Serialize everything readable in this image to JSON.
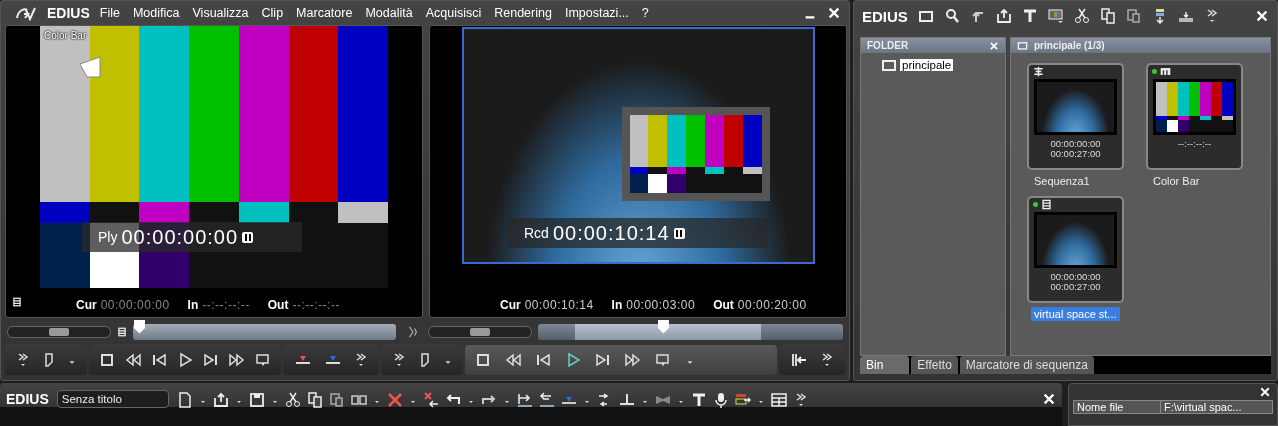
{
  "menu_bar": {
    "app_name": "EDIUS",
    "items": [
      "File",
      "Modifica",
      "Visualizza",
      "Clip",
      "Marcatore",
      "Modalità",
      "Acquisisci",
      "Rendering",
      "Impostazi...",
      "?"
    ]
  },
  "monitors": [
    {
      "kind": "player",
      "clip_label": "Color Bar",
      "mode": "Ply",
      "timecode": "00:00:00:00",
      "readouts": [
        {
          "label": "Cur",
          "value": "00:00:00:00"
        },
        {
          "label": "In",
          "value": "--:--:--:--"
        },
        {
          "label": "Out",
          "value": "--:--:--:--"
        }
      ],
      "shuttle": {
        "level": 0.5
      },
      "scrubber": {
        "level": 0.0
      }
    },
    {
      "kind": "recorder",
      "mode": "Rcd",
      "timecode": "00:00:10:14",
      "readouts": [
        {
          "label": "Cur",
          "value": "00:00:10:14"
        },
        {
          "label": "In",
          "value": "00:00:03:00"
        },
        {
          "label": "Out",
          "value": "00:00:20:00"
        }
      ],
      "shuttle": {
        "level": 0.5
      },
      "scrubber": {
        "level": 0.39
      }
    }
  ],
  "bin_window": {
    "app_name": "EDIUS",
    "folder_panel": {
      "title": "FOLDER",
      "items": [
        {
          "label": "principale",
          "selected": true
        }
      ]
    },
    "bin": {
      "title": "principale (1/3)",
      "clips": [
        {
          "kind": "sequence",
          "timecodes": [
            "00:00:00:00",
            "00:00:27:00"
          ],
          "name": "Sequenza1",
          "in_use": false,
          "selected": false
        },
        {
          "kind": "color_bar",
          "timecodes": [
            "--:--:--:--"
          ],
          "name": "Color Bar",
          "in_use": true,
          "selected": false
        },
        {
          "kind": "video",
          "timecodes": [
            "00:00:00:00",
            "00:00:27:00"
          ],
          "name": "virtual space st...",
          "in_use": true,
          "selected": true
        }
      ]
    },
    "tabs": [
      {
        "label": "Bin",
        "selected": true
      },
      {
        "label": "Effetto",
        "selected": false
      },
      {
        "label": "Marcatore di sequenza",
        "selected": false
      }
    ]
  },
  "timeline": {
    "app_name": "EDIUS",
    "project_name": "Senza titolo"
  },
  "info_panel": {
    "rows": [
      {
        "key": "Nome file",
        "value": "F:\\virtual spac..."
      }
    ]
  }
}
